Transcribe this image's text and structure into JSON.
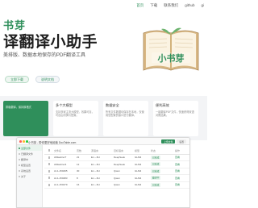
{
  "nav": {
    "items": [
      "首页",
      "下载",
      "联系我们",
      "github",
      "gi"
    ]
  },
  "hero": {
    "title_small": "书芽",
    "title_big": "译翻译小助手",
    "subtitle": "美排版、数据本地保存的PDF翻译工具",
    "primary_button": "立即下载",
    "secondary_button": "说明文档"
  },
  "illustration": {
    "label": "小书芽",
    "accent": "#2f8f5b"
  },
  "features": [
    {
      "title": "",
      "desc": "排版翻译，保持原格式"
    },
    {
      "title": "多个大模型",
      "desc": "支持多家主流大模型，效果可靠，可自由切换与配置。"
    },
    {
      "title": "数据安全",
      "desc": "所有文件数据均保存在本地，仅使用您配置的接口进行翻译。"
    },
    {
      "title": "便利高效",
      "desc": "一键翻译PDF文件，快速获得双语对照结果。"
    }
  ],
  "app": {
    "title": "小书芽 - 带你更好地阅读 DocTable.com",
    "toolbar": [
      "上传文件",
      "设置"
    ],
    "sidebar": [
      {
        "label": "全部文件",
        "active": true
      },
      {
        "label": "已翻译文件",
        "active": false
      },
      {
        "label": "翻译中",
        "active": false
      },
      {
        "label": "模型设置",
        "active": false
      },
      {
        "label": "系统设置",
        "active": false
      },
      {
        "label": "关于",
        "active": false
      }
    ],
    "table_headers": [
      "",
      "文件名",
      "页数",
      "源语言",
      "目标语言",
      "模型",
      "状态",
      "操作"
    ],
    "rows": [
      [
        "",
        "AMwebrer7",
        "21",
        "En→ZH",
        "DeepSeek",
        "GLM4",
        "已完成",
        "查看"
      ],
      [
        "",
        "AMwebrer4",
        "12",
        "En→ZH",
        "DeepSeek",
        "GLM4",
        "已完成",
        "查看"
      ],
      [
        "",
        "AI-1-150495",
        "30",
        "En→ZH",
        "Qwen",
        "GLM4",
        "已完成",
        "查看"
      ],
      [
        "",
        "AI-1-150483",
        "8",
        "En→ZH",
        "Qwen",
        "GLM4",
        "翻译中",
        "查看"
      ],
      [
        "",
        "AI-1-150479",
        "16",
        "En→ZH",
        "Qwen",
        "GLM4",
        "已完成",
        "查看"
      ]
    ]
  }
}
